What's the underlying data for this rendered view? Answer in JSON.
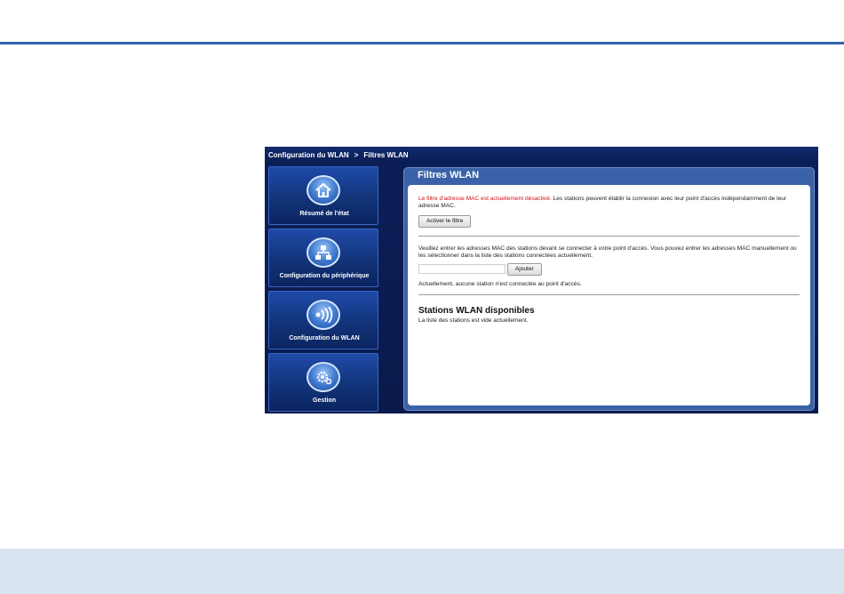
{
  "breadcrumb": {
    "parent": "Configuration du WLAN",
    "separator": ">",
    "current": "Filtres WLAN"
  },
  "nav": {
    "items": [
      {
        "label": "Résumé de l'état",
        "icon": "home-icon"
      },
      {
        "label": "Configuration du périphérique",
        "icon": "network-icon"
      },
      {
        "label": "Configuration du WLAN",
        "icon": "wireless-icon"
      },
      {
        "label": "Gestion",
        "icon": "gear-icon"
      }
    ]
  },
  "content": {
    "title": "Filtres WLAN",
    "status_warning": "Le filtre d'adresse MAC est actuellement désactivé.",
    "status_text": " Les stations peuvent établir la connexion avec leur point d'accès indépendamment de leur adresse MAC.",
    "activate_button": "Activer le filtre",
    "mac_instructions": "Veuillez entrer les adresses MAC des stations devant se connecter à votre point d'accès. Vous pouvez entrer les adresses MAC manuellement ou les sélectionner dans la liste des stations connectées actuellement.",
    "mac_input_value": "",
    "add_button": "Ajouter",
    "connected_status": "Actuellement, aucune station n'est connectée au point d'accès.",
    "stations_heading": "Stations WLAN disponibles",
    "stations_empty": "La liste des stations est vide actuellement."
  },
  "colors": {
    "top_rule": "#2e64b0",
    "bottom_band": "#d8e3ef",
    "warning": "#d0101a"
  }
}
